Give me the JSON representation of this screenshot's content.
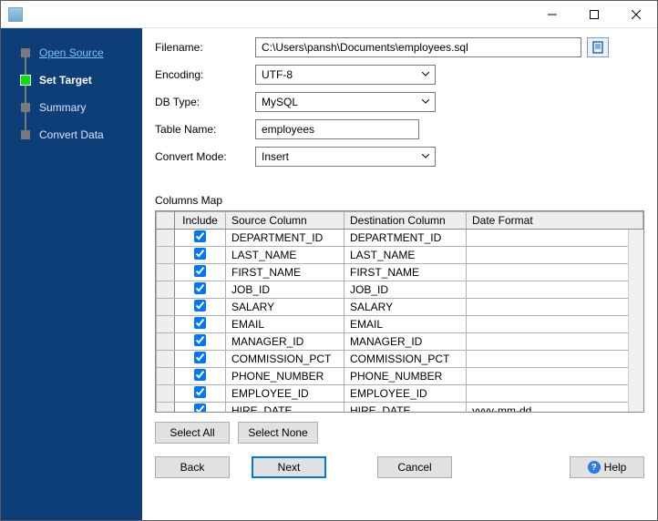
{
  "sidebar": {
    "steps": [
      {
        "label": "Open Source",
        "state": "link"
      },
      {
        "label": "Set Target",
        "state": "active"
      },
      {
        "label": "Summary",
        "state": "pending"
      },
      {
        "label": "Convert Data",
        "state": "pending"
      }
    ]
  },
  "form": {
    "filename_label": "Filename:",
    "filename_value": "C:\\Users\\pansh\\Documents\\employees.sql",
    "encoding_label": "Encoding:",
    "encoding_value": "UTF-8",
    "dbtype_label": "DB Type:",
    "dbtype_value": "MySQL",
    "tablename_label": "Table Name:",
    "tablename_value": "employees",
    "convertmode_label": "Convert Mode:",
    "convertmode_value": "Insert"
  },
  "columns_map": {
    "title": "Columns Map",
    "headers": {
      "include": "Include",
      "source": "Source Column",
      "destination": "Destination Column",
      "dateformat": "Date Format"
    },
    "rows": [
      {
        "include": true,
        "source": "DEPARTMENT_ID",
        "destination": "DEPARTMENT_ID",
        "dateformat": ""
      },
      {
        "include": true,
        "source": "LAST_NAME",
        "destination": "LAST_NAME",
        "dateformat": ""
      },
      {
        "include": true,
        "source": "FIRST_NAME",
        "destination": "FIRST_NAME",
        "dateformat": ""
      },
      {
        "include": true,
        "source": "JOB_ID",
        "destination": "JOB_ID",
        "dateformat": ""
      },
      {
        "include": true,
        "source": "SALARY",
        "destination": "SALARY",
        "dateformat": ""
      },
      {
        "include": true,
        "source": "EMAIL",
        "destination": "EMAIL",
        "dateformat": ""
      },
      {
        "include": true,
        "source": "MANAGER_ID",
        "destination": "MANAGER_ID",
        "dateformat": ""
      },
      {
        "include": true,
        "source": "COMMISSION_PCT",
        "destination": "COMMISSION_PCT",
        "dateformat": ""
      },
      {
        "include": true,
        "source": "PHONE_NUMBER",
        "destination": "PHONE_NUMBER",
        "dateformat": ""
      },
      {
        "include": true,
        "source": "EMPLOYEE_ID",
        "destination": "EMPLOYEE_ID",
        "dateformat": ""
      },
      {
        "include": true,
        "source": "HIRE_DATE",
        "destination": "HIRE_DATE",
        "dateformat": "yyyy-mm-dd"
      }
    ]
  },
  "buttons": {
    "select_all": "Select All",
    "select_none": "Select None",
    "back": "Back",
    "next": "Next",
    "cancel": "Cancel",
    "help": "Help"
  }
}
